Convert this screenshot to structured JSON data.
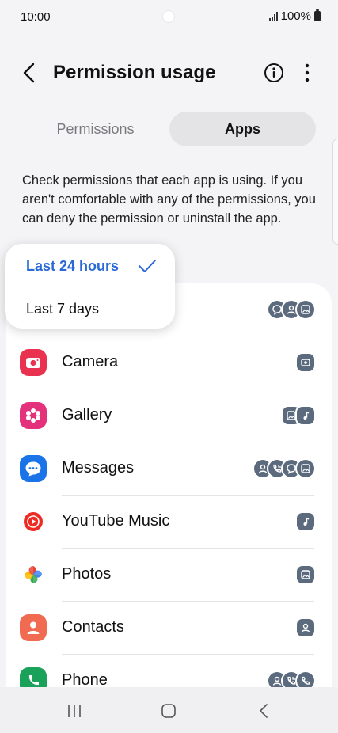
{
  "status_bar": {
    "time": "10:00",
    "battery": "100%"
  },
  "header": {
    "title": "Permission usage"
  },
  "tabs": [
    {
      "label": "Permissions",
      "selected": false
    },
    {
      "label": "Apps",
      "selected": true
    }
  ],
  "description": "Check permissions that each app is using. If you aren't comfortable with any of the permissions, you can deny the permission or uninstall the app.",
  "time_filter": {
    "options": [
      "Last 24 hours",
      "Last 7 days"
    ],
    "selected": "Last 24 hours"
  },
  "apps": [
    {
      "name": "Camera",
      "icon": "camera-app-icon",
      "permissions": [
        "camera"
      ]
    },
    {
      "name": "Gallery",
      "icon": "gallery-app-icon",
      "permissions": [
        "photos",
        "music"
      ]
    },
    {
      "name": "Messages",
      "icon": "messages-app-icon",
      "permissions": [
        "contacts",
        "call-logs",
        "sms",
        "photos"
      ]
    },
    {
      "name": "YouTube Music",
      "icon": "youtube-music-app-icon",
      "permissions": [
        "music"
      ]
    },
    {
      "name": "Photos",
      "icon": "photos-app-icon",
      "permissions": [
        "photos"
      ]
    },
    {
      "name": "Contacts",
      "icon": "contacts-app-icon",
      "permissions": [
        "contacts"
      ]
    },
    {
      "name": "Phone",
      "icon": "phone-app-icon",
      "permissions": [
        "contacts",
        "call-logs",
        "phone"
      ]
    }
  ],
  "first_row_permissions": [
    "sms",
    "contacts",
    "photos"
  ],
  "colors": {
    "accent": "#2a6ad4",
    "permission_badge": "#5c6a7e",
    "camera": "#e8324f",
    "gallery": "#e3327b",
    "messages": "#1b73e8",
    "youtube_music": "#ee2b23",
    "contacts": "#f06b52",
    "phone": "#1aa15a"
  }
}
